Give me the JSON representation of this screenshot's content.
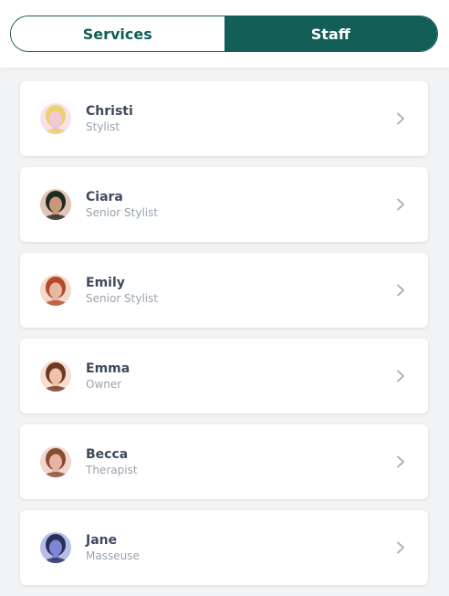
{
  "tabs": [
    {
      "label": "Services",
      "active": false
    },
    {
      "label": "Staff",
      "active": true
    }
  ],
  "colors": {
    "accent": "#135e57",
    "name_text": "#3e4a5c",
    "role_text": "#9aa3ae"
  },
  "staff": [
    {
      "name": "Christi",
      "role": "Stylist",
      "avatar": "avatar-christi",
      "tone": "#f3c8d6",
      "hair": "#e9d26b"
    },
    {
      "name": "Ciara",
      "role": "Senior Stylist",
      "avatar": "avatar-ciara",
      "tone": "#c99878",
      "hair": "#1f2a24"
    },
    {
      "name": "Emily",
      "role": "Senior Stylist",
      "avatar": "avatar-emily",
      "tone": "#e6b9a3",
      "hair": "#b8482c"
    },
    {
      "name": "Emma",
      "role": "Owner",
      "avatar": "avatar-emma",
      "tone": "#f1c2a8",
      "hair": "#6b3a25"
    },
    {
      "name": "Becca",
      "role": "Therapist",
      "avatar": "avatar-becca",
      "tone": "#e6b4a0",
      "hair": "#8a4b33"
    },
    {
      "name": "Jane",
      "role": "Masseuse",
      "avatar": "avatar-jane",
      "tone": "#7b86d9",
      "hair": "#2b2f55"
    }
  ],
  "icons": {
    "chevron": "chevron-right-icon"
  }
}
